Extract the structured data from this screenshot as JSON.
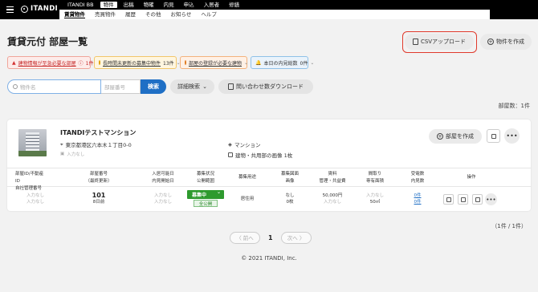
{
  "nav": {
    "logo": "ITANDI",
    "top": [
      "ITANDI BB",
      "物件",
      "出稿",
      "物確",
      "内見",
      "申込",
      "入居者",
      "修繕"
    ],
    "sub": [
      "賃貸物件",
      "売買物件",
      "履歴",
      "その他",
      "お知らせ",
      "ヘルプ"
    ]
  },
  "header": {
    "title": "賃貸元付 部屋一覧",
    "csv_label": "CSVアップロード",
    "create_label": "物件を作成"
  },
  "chips": {
    "red": {
      "label": "建物情報が至急必要な部屋",
      "count": "1件"
    },
    "yellow": {
      "label": "長時間未更新の募集中物件",
      "count": "13件"
    },
    "orange": {
      "label": "部屋の登録が必要な建物"
    },
    "blue": {
      "label": "本日の内見総数",
      "count": "0件"
    }
  },
  "search": {
    "name_placeholder": "物件名",
    "room_placeholder": "部屋番号",
    "button": "検索",
    "detail": "詳細検索",
    "download": "問い合わせ数ダウンロード"
  },
  "room_count": "部屋数：1件",
  "building": {
    "name": "ITANDIテストマンション",
    "address": "東京都港区六本木１丁目0-0",
    "nodata": "入力なし",
    "type": "マンション",
    "images": "建物・共用部の画像 1枚",
    "create_room": "部屋を作成"
  },
  "table": {
    "headers": {
      "id_a": "部屋ID/不動産ID",
      "id_b": "自社管理番号",
      "room_a": "部屋番号",
      "room_b": "（最終更新）",
      "move_a": "入居可能日",
      "move_b": "内見開始日",
      "status_a": "募集状況",
      "status_b": "公開範囲",
      "usage": "募集用途",
      "plan_a": "募集図面",
      "plan_b": "画像",
      "rent_a": "賃料",
      "rent_b": "管理・共益費",
      "layout_a": "間取り",
      "layout_b": "専有面積",
      "inq_a": "受電数",
      "inq_b": "内見数",
      "ops": "操作"
    },
    "row": {
      "id1": "入力なし",
      "id2": "入力なし",
      "room_no": "101",
      "updated": "8日前",
      "move1": "入力なし",
      "move2": "入力なし",
      "status": "募集中",
      "public": "全公開",
      "usage": "居住用",
      "plan": "なし",
      "images": "0枚",
      "rent": "50,000円",
      "fee": "入力なし",
      "layout": "入力なし",
      "area": "50㎡",
      "calls": "0件",
      "viewings": "0件"
    }
  },
  "pagination": {
    "count": "（1件 / 1件）",
    "prev": "〈 前へ",
    "current": "1",
    "next": "次へ 〉"
  },
  "footer": "© 2021 ITANDI, Inc."
}
